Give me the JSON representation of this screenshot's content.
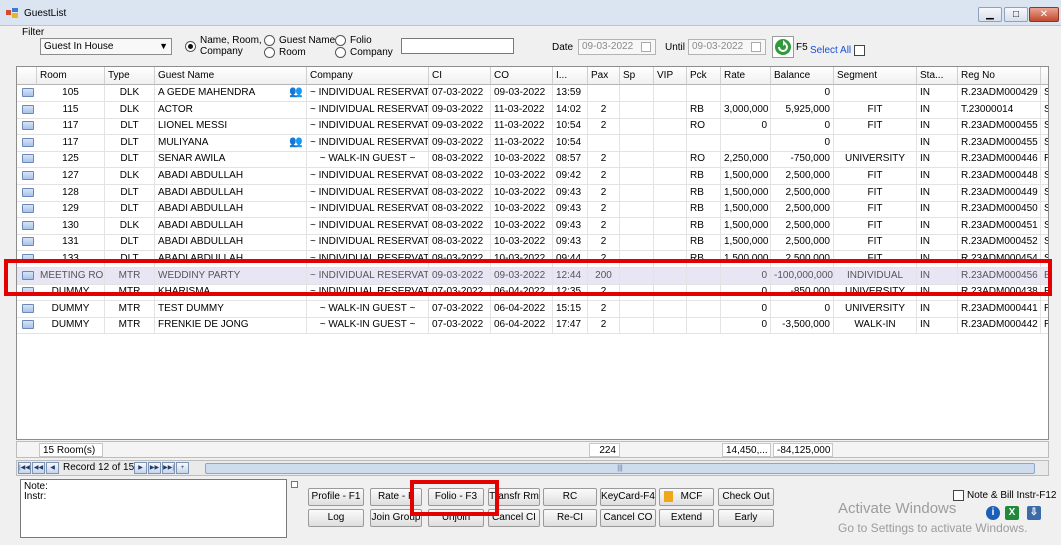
{
  "window": {
    "title": "GuestList",
    "minimize": "▁",
    "maximize": "□",
    "close": "✕"
  },
  "filter": {
    "group_label": "Filter",
    "combo_value": "Guest In House",
    "radios": [
      {
        "label_line1": "Name, Room,",
        "label_line2": "Company",
        "checked": true
      },
      {
        "label_line1": "Guest Name",
        "checked": false
      },
      {
        "label_line1": "Room",
        "checked": false
      },
      {
        "label_line1": "Folio",
        "checked": false
      },
      {
        "label_line1": "Company",
        "checked": false
      }
    ],
    "search_value": "",
    "date_label": "Date",
    "date_value": "09-03-2022",
    "until_label": "Until",
    "until_value": "09-03-2022",
    "refresh_hotkey": "F5",
    "select_all_label": "Select All"
  },
  "grid": {
    "columns": [
      "Room",
      "Type",
      "Guest Name",
      "Company",
      "CI",
      "CO",
      "I...",
      "Pax",
      "Sp",
      "VIP",
      "Pck",
      "Rate",
      "Balance",
      "Segment",
      "Sta...",
      "Reg No",
      ""
    ],
    "rows": [
      {
        "room": "105",
        "type": "DLK",
        "guest": "A GEDE MAHENDRA",
        "group_icon": true,
        "company": "~ INDIVIDUAL RESERVATI...",
        "ci": "07-03-2022",
        "co": "09-03-2022",
        "time": "13:59",
        "pax": "",
        "pck": "",
        "rate": "",
        "balance": "0",
        "segment": "",
        "status": "IN",
        "regno": "R.23ADM000429",
        "extra": "S"
      },
      {
        "room": "115",
        "type": "DLK",
        "guest": "ACTOR",
        "group_icon": false,
        "company": "~ INDIVIDUAL RESERVATI...",
        "ci": "09-03-2022",
        "co": "11-03-2022",
        "time": "14:02",
        "pax": "2",
        "pck": "RB",
        "rate": "3,000,000",
        "balance": "5,925,000",
        "segment": "FIT",
        "status": "IN",
        "regno": "T.23000014",
        "extra": "S"
      },
      {
        "room": "117",
        "type": "DLT",
        "guest": "LIONEL MESSI",
        "group_icon": false,
        "company": "~ INDIVIDUAL RESERVATI...",
        "ci": "09-03-2022",
        "co": "11-03-2022",
        "time": "10:54",
        "pax": "2",
        "pck": "RO",
        "rate": "0",
        "balance": "0",
        "segment": "FIT",
        "status": "IN",
        "regno": "R.23ADM000455",
        "extra": "S"
      },
      {
        "room": "117",
        "type": "DLT",
        "guest": "MULIYANA",
        "group_icon": true,
        "company": "~ INDIVIDUAL RESERVATI...",
        "ci": "09-03-2022",
        "co": "11-03-2022",
        "time": "10:54",
        "pax": "",
        "pck": "",
        "rate": "",
        "balance": "0",
        "segment": "",
        "status": "IN",
        "regno": "R.23ADM000455",
        "extra": "S"
      },
      {
        "room": "125",
        "type": "DLT",
        "guest": "SENAR AWILA",
        "group_icon": false,
        "company": "~ WALK-IN GUEST ~",
        "ci": "08-03-2022",
        "co": "10-03-2022",
        "time": "08:57",
        "pax": "2",
        "pck": "RO",
        "rate": "2,250,000",
        "balance": "-750,000",
        "segment": "UNIVERSITY",
        "status": "IN",
        "regno": "R.23ADM000446",
        "extra": "R"
      },
      {
        "room": "127",
        "type": "DLK",
        "guest": "ABADI ABDULLAH",
        "group_icon": false,
        "company": "~ INDIVIDUAL RESERVATI...",
        "ci": "08-03-2022",
        "co": "10-03-2022",
        "time": "09:42",
        "pax": "2",
        "pck": "RB",
        "rate": "1,500,000",
        "balance": "2,500,000",
        "segment": "FIT",
        "status": "IN",
        "regno": "R.23ADM000448",
        "extra": "S"
      },
      {
        "room": "128",
        "type": "DLT",
        "guest": "ABADI ABDULLAH",
        "group_icon": false,
        "company": "~ INDIVIDUAL RESERVATI...",
        "ci": "08-03-2022",
        "co": "10-03-2022",
        "time": "09:43",
        "pax": "2",
        "pck": "RB",
        "rate": "1,500,000",
        "balance": "2,500,000",
        "segment": "FIT",
        "status": "IN",
        "regno": "R.23ADM000449",
        "extra": "S"
      },
      {
        "room": "129",
        "type": "DLT",
        "guest": "ABADI ABDULLAH",
        "group_icon": false,
        "company": "~ INDIVIDUAL RESERVATI...",
        "ci": "08-03-2022",
        "co": "10-03-2022",
        "time": "09:43",
        "pax": "2",
        "pck": "RB",
        "rate": "1,500,000",
        "balance": "2,500,000",
        "segment": "FIT",
        "status": "IN",
        "regno": "R.23ADM000450",
        "extra": "S"
      },
      {
        "room": "130",
        "type": "DLK",
        "guest": "ABADI ABDULLAH",
        "group_icon": false,
        "company": "~ INDIVIDUAL RESERVATI...",
        "ci": "08-03-2022",
        "co": "10-03-2022",
        "time": "09:43",
        "pax": "2",
        "pck": "RB",
        "rate": "1,500,000",
        "balance": "2,500,000",
        "segment": "FIT",
        "status": "IN",
        "regno": "R.23ADM000451",
        "extra": "S"
      },
      {
        "room": "131",
        "type": "DLT",
        "guest": "ABADI ABDULLAH",
        "group_icon": false,
        "company": "~ INDIVIDUAL RESERVATI...",
        "ci": "08-03-2022",
        "co": "10-03-2022",
        "time": "09:43",
        "pax": "2",
        "pck": "RB",
        "rate": "1,500,000",
        "balance": "2,500,000",
        "segment": "FIT",
        "status": "IN",
        "regno": "R.23ADM000452",
        "extra": "S"
      },
      {
        "room": "133",
        "type": "DLT",
        "guest": "ABADI ABDULLAH",
        "group_icon": false,
        "company": "~ INDIVIDUAL RESERVATI...",
        "ci": "08-03-2022",
        "co": "10-03-2022",
        "time": "09:44",
        "pax": "2",
        "pck": "RB",
        "rate": "1,500,000",
        "balance": "2,500,000",
        "segment": "FIT",
        "status": "IN",
        "regno": "R.23ADM000454",
        "extra": "S"
      },
      {
        "room": "MEETING RO...",
        "type": "MTR",
        "guest": "WEDDINY PARTY",
        "group_icon": false,
        "company": "~ INDIVIDUAL RESERVATI...",
        "ci": "09-03-2022",
        "co": "09-03-2022",
        "time": "12:44",
        "pax": "200",
        "pck": "",
        "rate": "0",
        "balance": "-100,000,000",
        "segment": "INDIVIDUAL",
        "status": "IN",
        "regno": "R.23ADM000456",
        "extra": "B",
        "selected": true
      },
      {
        "room": "DUMMY",
        "type": "MTR",
        "guest": "KHARISMA",
        "group_icon": false,
        "company": "~ INDIVIDUAL RESERVATI...",
        "ci": "07-03-2022",
        "co": "06-04-2022",
        "time": "12:35",
        "pax": "2",
        "pck": "",
        "rate": "0",
        "balance": "-850,000",
        "segment": "UNIVERSITY",
        "status": "IN",
        "regno": "R.23ADM000438",
        "extra": "R"
      },
      {
        "room": "DUMMY",
        "type": "MTR",
        "guest": "TEST DUMMY",
        "group_icon": false,
        "company": "~ WALK-IN GUEST ~",
        "ci": "07-03-2022",
        "co": "06-04-2022",
        "time": "15:15",
        "pax": "2",
        "pck": "",
        "rate": "0",
        "balance": "0",
        "segment": "UNIVERSITY",
        "status": "IN",
        "regno": "R.23ADM000441",
        "extra": "R"
      },
      {
        "room": "DUMMY",
        "type": "MTR",
        "guest": "FRENKIE DE JONG",
        "group_icon": false,
        "company": "~ WALK-IN GUEST ~",
        "ci": "07-03-2022",
        "co": "06-04-2022",
        "time": "17:47",
        "pax": "2",
        "pck": "",
        "rate": "0",
        "balance": "-3,500,000",
        "segment": "WALK-IN",
        "status": "IN",
        "regno": "R.23ADM000442",
        "extra": "R"
      }
    ]
  },
  "totals": {
    "rooms": "15 Room(s)",
    "pax": "224",
    "rate": "14,450,...",
    "balance": "-84,125,000"
  },
  "navigator": {
    "record_text": "Record 12 of 15",
    "first": "|◀◀",
    "prev_page": "◀◀",
    "prev": "◀",
    "next": "▶",
    "next_page": "▶▶",
    "last": "▶▶|",
    "add": "+",
    "scroll_grip": "|||"
  },
  "note": {
    "note_label": "Note:",
    "instr_label": "Instr:"
  },
  "buttons": {
    "row1": [
      "Profile - F1",
      "Rate - F",
      "Folio - F3",
      "Transfr Rm",
      "RC",
      "KeyCard-F4",
      "MCF",
      "Check Out"
    ],
    "row2": [
      "Log",
      "Join Group",
      "Unjoin",
      "Cancel CI",
      "Re-CI",
      "Cancel CO",
      "Extend",
      "Early"
    ]
  },
  "note_bill_label": "Note & Bill Instr-F12",
  "watermark": {
    "line1": "Activate Windows",
    "line2": "Go to Settings to activate Windows."
  }
}
